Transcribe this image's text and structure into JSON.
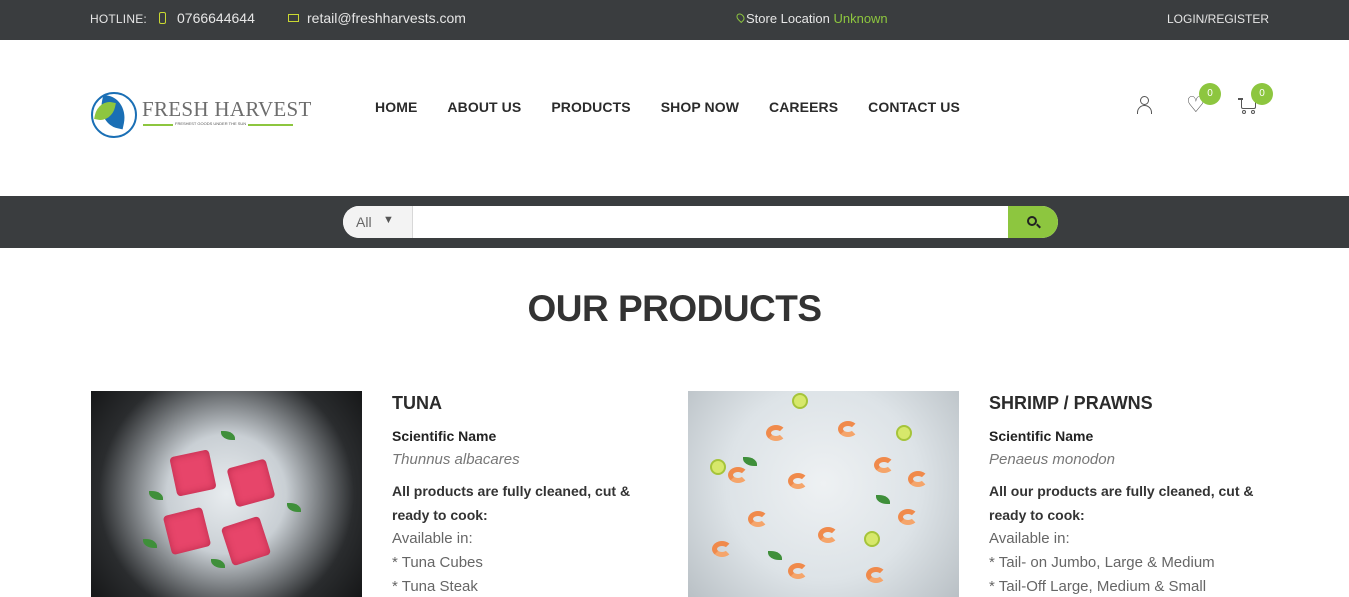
{
  "topbar": {
    "hotline_label": "HOTLINE:",
    "phone": "0766644644",
    "email": "retail@freshharvests.com",
    "store_label": "Store Location",
    "store_value": "Unknown",
    "login": "LOGIN/REGISTER",
    "icons": [
      "phone-icon",
      "mail-icon",
      "pin-icon"
    ]
  },
  "header": {
    "brand": "FRESH HARVEST",
    "tagline": "FRESHEST GOODS UNDER THE SUN",
    "nav": [
      "HOME",
      "ABOUT US",
      "PRODUCTS",
      "SHOP NOW",
      "CAREERS",
      "CONTACT US"
    ],
    "wishlist_count": "0",
    "cart_count": "0",
    "icons": [
      "user-icon",
      "heart-icon",
      "cart-icon"
    ]
  },
  "search": {
    "category": "All",
    "placeholder": "",
    "icon": "search-icon"
  },
  "main": {
    "title": "OUR PRODUCTS",
    "products": [
      {
        "name": "TUNA",
        "sci_label": "Scientific Name",
        "sci_value": "Thunnus albacares",
        "prep": "All products are fully cleaned, cut & ready to cook:",
        "avail_label": "Available in:",
        "items": [
          "* Tuna Cubes",
          "* Tuna Steak"
        ]
      },
      {
        "name": "SHRIMP / PRAWNS",
        "sci_label": "Scientific Name",
        "sci_value": "Penaeus monodon",
        "prep": "All our products are fully cleaned, cut & ready to cook:",
        "avail_label": "Available in:",
        "items": [
          "* Tail- on Jumbo, Large & Medium",
          "* Tail-Off Large, Medium & Small"
        ]
      }
    ]
  },
  "colors": {
    "dark_bar": "#3a3d3f",
    "accent_green": "#8dc63f",
    "brand_blue": "#1a6fb5"
  }
}
